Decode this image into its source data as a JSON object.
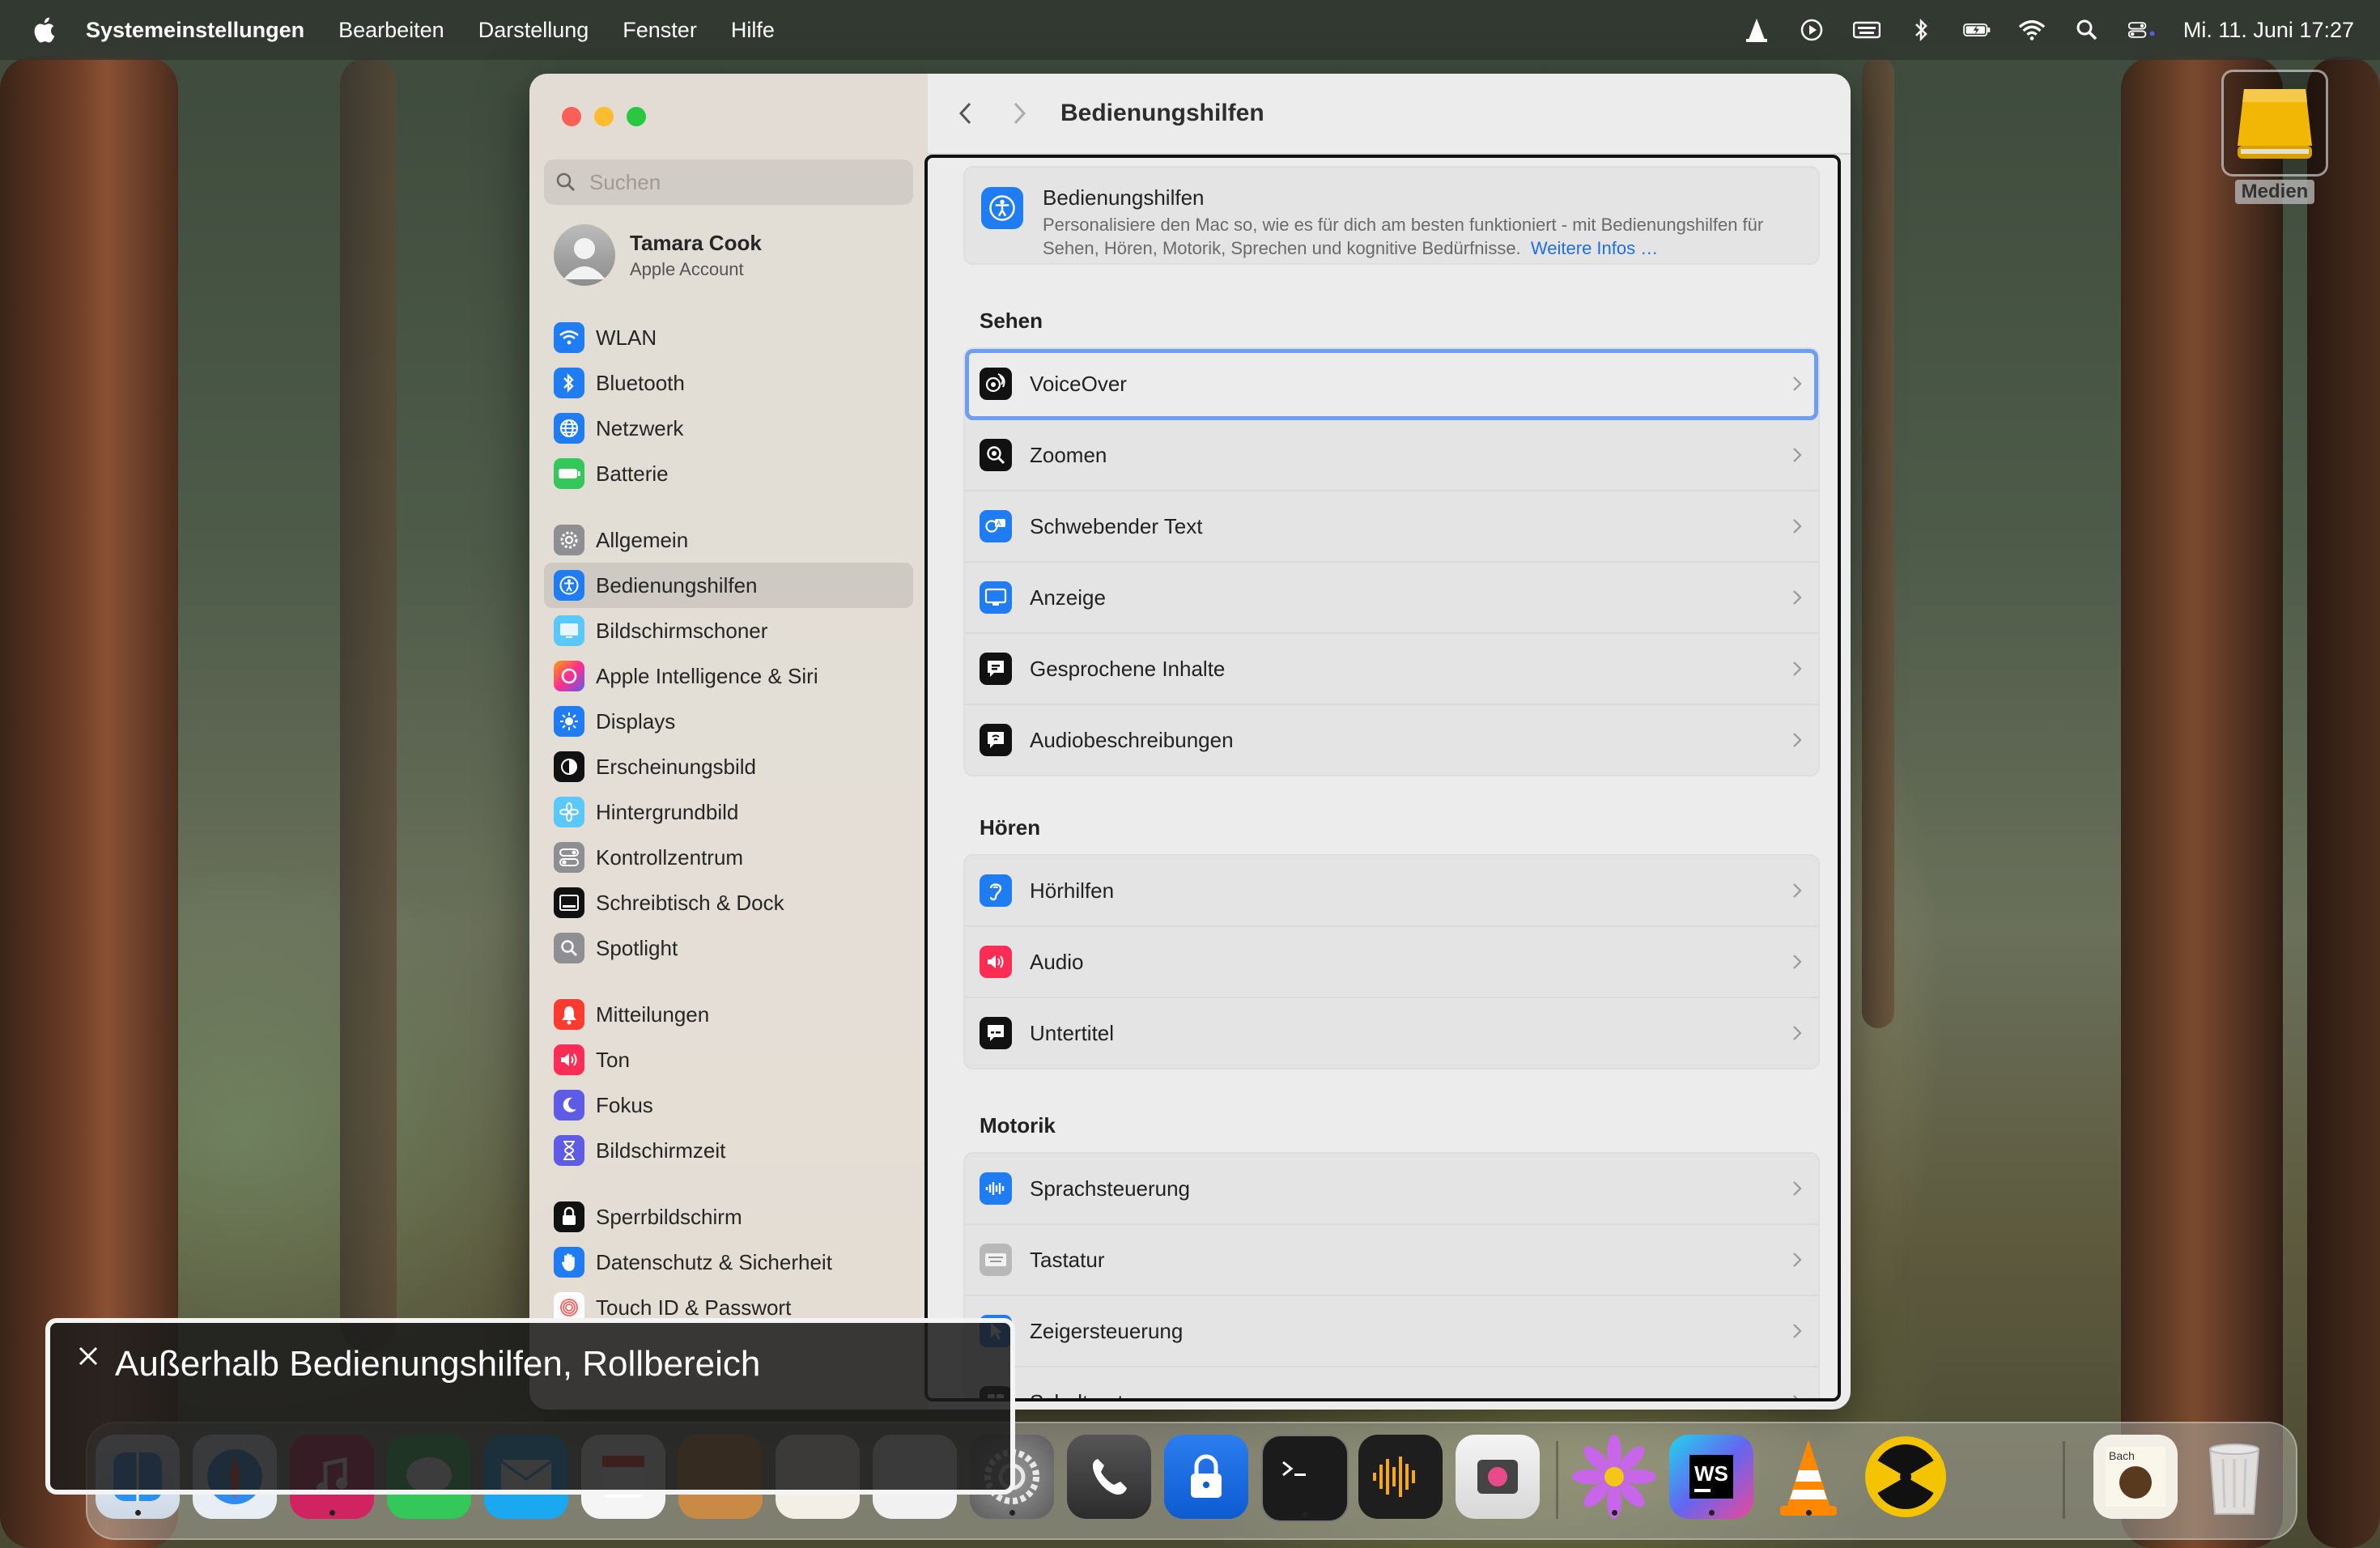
{
  "menubar": {
    "app": "Systemeinstellungen",
    "items": [
      "Bearbeiten",
      "Darstellung",
      "Fenster",
      "Hilfe"
    ],
    "clock": "Mi. 11. Juni  17:27"
  },
  "desktop": {
    "drive_label": "Medien"
  },
  "sidebar": {
    "search_placeholder": "Suchen",
    "account": {
      "name": "Tamara Cook",
      "subtitle": "Apple Account"
    },
    "items": [
      {
        "label": "WLAN",
        "color": "#1f7cf3"
      },
      {
        "label": "Bluetooth",
        "color": "#1f7cf3"
      },
      {
        "label": "Netzwerk",
        "color": "#1f7cf3"
      },
      {
        "label": "Batterie",
        "color": "#34c759"
      },
      {
        "label": "Allgemein",
        "color": "#8e8e93"
      },
      {
        "label": "Bedienungshilfen",
        "color": "#1f7cf3"
      },
      {
        "label": "Bildschirmschoner",
        "color": "#5ac8fa"
      },
      {
        "label": "Apple Intelligence & Siri",
        "color": "#ff6fb5"
      },
      {
        "label": "Displays",
        "color": "#1f7cf3"
      },
      {
        "label": "Erscheinungsbild",
        "color": "#111111"
      },
      {
        "label": "Hintergrundbild",
        "color": "#5ac8fa"
      },
      {
        "label": "Kontrollzentrum",
        "color": "#8e8e93"
      },
      {
        "label": "Schreibtisch & Dock",
        "color": "#111111"
      },
      {
        "label": "Spotlight",
        "color": "#8e8e93"
      },
      {
        "label": "Mitteilungen",
        "color": "#ff3b30"
      },
      {
        "label": "Ton",
        "color": "#ff2d55"
      },
      {
        "label": "Fokus",
        "color": "#5e5ce6"
      },
      {
        "label": "Bildschirmzeit",
        "color": "#5e5ce6"
      },
      {
        "label": "Sperrbildschirm",
        "color": "#111111"
      },
      {
        "label": "Datenschutz & Sicherheit",
        "color": "#1f7cf3"
      },
      {
        "label": "Touch ID & Passwort",
        "color": "#ff6b6b"
      }
    ]
  },
  "content": {
    "title": "Bedienungshilfen",
    "intro": {
      "title": "Bedienungshilfen",
      "desc": "Personalisiere den Mac so, wie es für dich am besten funktioniert - mit Bedienungshilfen für Sehen, Hören, Motorik, Sprechen und kognitive Bedürfnisse.",
      "link": "Weitere Infos …"
    },
    "sections": [
      {
        "title": "Sehen",
        "rows": [
          "VoiceOver",
          "Zoomen",
          "Schwebender Text",
          "Anzeige",
          "Gesprochene Inhalte",
          "Audiobeschreibungen"
        ]
      },
      {
        "title": "Hören",
        "rows": [
          "Hörhilfen",
          "Audio",
          "Untertitel"
        ]
      },
      {
        "title": "Motorik",
        "rows": [
          "Sprachsteuerung",
          "Tastatur",
          "Zeigersteuerung",
          "Schaltersteuerung"
        ]
      }
    ]
  },
  "voiceover_caption": "Außerhalb Bedienungshilfen, Rollbereich"
}
